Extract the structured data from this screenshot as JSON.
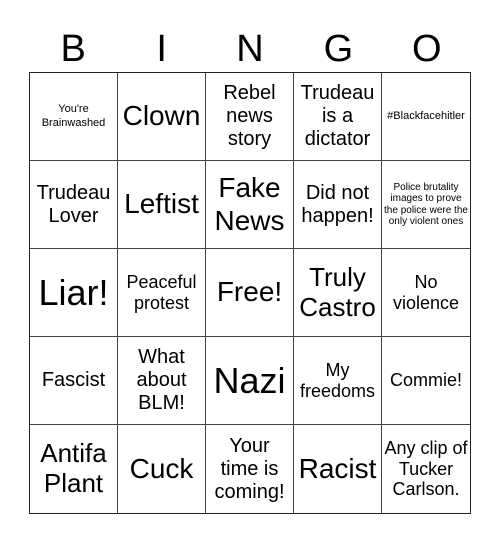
{
  "header": {
    "letters": [
      "B",
      "I",
      "N",
      "G",
      "O"
    ]
  },
  "board": {
    "rows": [
      [
        "You're Brainwashed",
        "Clown",
        "Rebel news story",
        "Trudeau is a dictator",
        "#Blackfacehitler"
      ],
      [
        "Trudeau Lover",
        "Leftist",
        "Fake News",
        "Did not happen!",
        "Police brutality images to prove the police were the only violent ones"
      ],
      [
        "Liar!",
        "Peaceful protest",
        "Free!",
        "Truly Castro",
        "No violence"
      ],
      [
        "Fascist",
        "What about BLM!",
        "Nazi",
        "My freedoms",
        "Commie!"
      ],
      [
        "Antifa Plant",
        "Cuck",
        "Your time is coming!",
        "Racist",
        "Any clip of Tucker Carlson."
      ]
    ]
  }
}
